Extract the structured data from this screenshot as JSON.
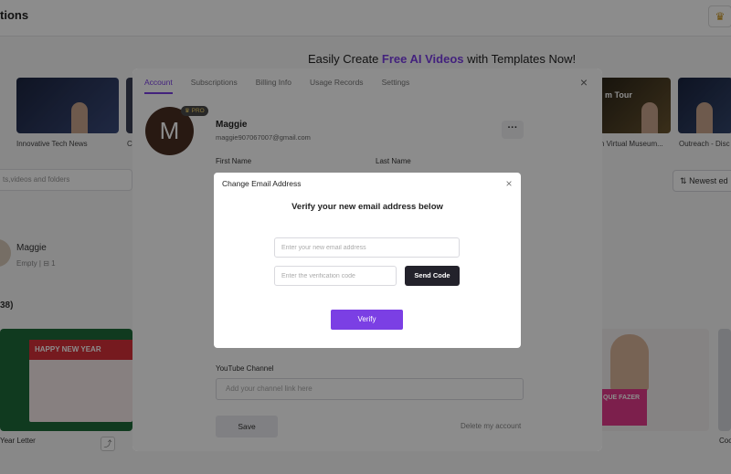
{
  "background": {
    "title": "tions",
    "banner": {
      "prefix": "Easily Create ",
      "highlight": "Free AI Videos",
      "suffix": " with Templates Now!"
    },
    "thumb3_badge": "m Tour",
    "thumbnails": [
      {
        "caption": "Innovative Tech News"
      },
      {
        "caption": "C"
      },
      {
        "caption": "n Virtual Museum..."
      },
      {
        "caption": "Outreach - Disc"
      }
    ],
    "search_placeholder": "ts,videos and folders",
    "sort_label": "Newest ed",
    "profile": {
      "name": "Maggie",
      "meta": "Empty  |  ⊟ 1"
    },
    "count_label": "38)",
    "card1_header": "HAPPY NEW YEAR",
    "card2_text": "QUE FAZER",
    "card_captions": [
      "Year Letter",
      "Coo"
    ]
  },
  "account_modal": {
    "tabs": [
      "Account",
      "Subscriptions",
      "Billing Info",
      "Usage Records",
      "Settings"
    ],
    "active_tab": "Account",
    "avatar_letter": "M",
    "pro_badge": "♛ PRO",
    "user_name": "Maggie",
    "user_email": "maggie907067007@gmail.com",
    "more_label": "···",
    "first_name_label": "First Name",
    "last_name_label": "Last Name",
    "youtube_label": "YouTube Channel",
    "youtube_placeholder": "Add your channel link here",
    "save_label": "Save",
    "delete_label": "Delete my account"
  },
  "email_dialog": {
    "title": "Change Email Address",
    "heading": "Verify your new email address below",
    "email_placeholder": "Enter your new email address",
    "code_placeholder": "Enter the verification code",
    "send_code_label": "Send Code",
    "verify_label": "Verify"
  },
  "icons": {
    "close": "×",
    "crown": "♛",
    "share": "⤴",
    "sort": "⇅"
  },
  "colors": {
    "accent": "#7b3fe4",
    "dark_button": "#23222b",
    "overlay": "rgba(0,0,0,0.45)"
  }
}
